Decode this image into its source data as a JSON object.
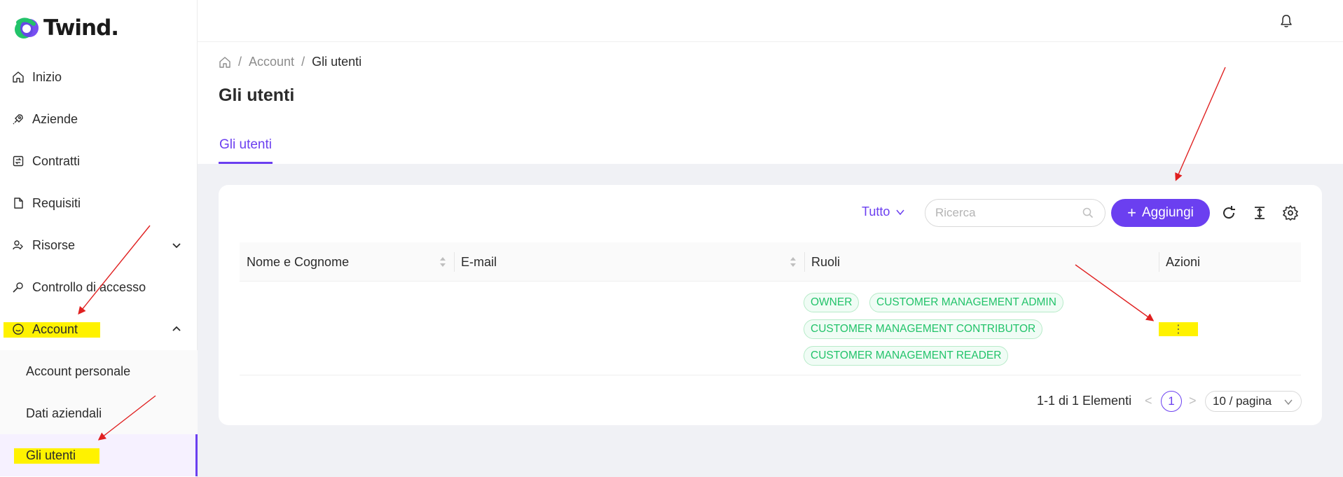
{
  "brand": {
    "name": "Twind."
  },
  "sidebar": {
    "items": [
      {
        "label": "Inizio",
        "icon": "home-icon"
      },
      {
        "label": "Aziende",
        "icon": "rocket-icon"
      },
      {
        "label": "Contratti",
        "icon": "contract-icon"
      },
      {
        "label": "Requisiti",
        "icon": "document-icon"
      },
      {
        "label": "Risorse",
        "icon": "resources-icon",
        "expanded": false
      },
      {
        "label": "Controllo di accesso",
        "icon": "key-icon"
      },
      {
        "label": "Account",
        "icon": "smile-icon",
        "expanded": true
      }
    ],
    "sub_items": [
      {
        "label": "Account personale"
      },
      {
        "label": "Dati aziendali"
      },
      {
        "label": "Gli utenti",
        "active": true
      }
    ]
  },
  "breadcrumb": {
    "items": [
      "Account",
      "Gli utenti"
    ],
    "separator": "/"
  },
  "page": {
    "title": "Gli utenti",
    "tab": "Gli utenti"
  },
  "toolbar": {
    "filter_label": "Tutto",
    "search_placeholder": "Ricerca",
    "add_label": "Aggiungi"
  },
  "table": {
    "columns": [
      "Nome e Cognome",
      "E-mail",
      "Ruoli",
      "Azioni"
    ],
    "rows": [
      {
        "name": "",
        "email": "",
        "roles": [
          "OWNER",
          "CUSTOMER MANAGEMENT ADMIN",
          "CUSTOMER MANAGEMENT CONTRIBUTOR",
          "CUSTOMER MANAGEMENT READER"
        ],
        "actions": "⋮"
      }
    ]
  },
  "pagination": {
    "total_text": "1-1 di 1 Elementi",
    "prev": "<",
    "current_page": "1",
    "next": ">",
    "page_size": "10 / pagina"
  },
  "colors": {
    "accent": "#6b3ff0",
    "tag_green": "#22c36a",
    "highlight": "#fff200",
    "arrow": "#e02020"
  }
}
